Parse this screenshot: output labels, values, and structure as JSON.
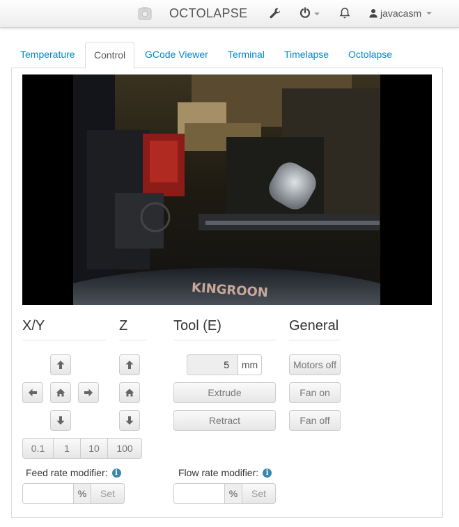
{
  "navbar": {
    "brand": "OCTOLAPSE",
    "username": "javacasm",
    "icons": [
      "octoprint-logo-icon",
      "wrench-icon",
      "power-icon",
      "bell-icon",
      "user-icon"
    ]
  },
  "tabs": [
    {
      "label": "Temperature"
    },
    {
      "label": "Control"
    },
    {
      "label": "GCode Viewer"
    },
    {
      "label": "Terminal"
    },
    {
      "label": "Timelapse"
    },
    {
      "label": "Octolapse"
    }
  ],
  "active_tab": "Control",
  "webcam": {
    "print_bed_brand": "KINGROON"
  },
  "sections": {
    "xy": "X/Y",
    "z": "Z",
    "tool": "Tool (E)",
    "general": "General"
  },
  "jog": {
    "step_sizes": [
      "0.1",
      "1",
      "10",
      "100"
    ]
  },
  "tool": {
    "amount": "5",
    "unit": "mm",
    "extrude_label": "Extrude",
    "retract_label": "Retract"
  },
  "general": {
    "motors_off_label": "Motors off",
    "fan_on_label": "Fan on",
    "fan_off_label": "Fan off"
  },
  "feed_rate": {
    "label": "Feed rate modifier:",
    "value": "",
    "unit": "%",
    "set_label": "Set"
  },
  "flow_rate": {
    "label": "Flow rate modifier:",
    "value": "",
    "unit": "%",
    "set_label": "Set"
  },
  "colors": {
    "link": "#0088cc",
    "info": "#3a87ad",
    "button_text": "#777777"
  }
}
